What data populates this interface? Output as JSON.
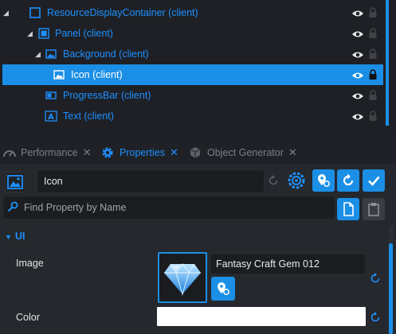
{
  "hierarchy": {
    "items": [
      {
        "label": "ResourceDisplayContainer (client)",
        "icon": "container-icon",
        "expanded": true,
        "depth": 0
      },
      {
        "label": "Panel (client)",
        "icon": "panel-icon",
        "expanded": true,
        "depth": 1
      },
      {
        "label": "Background (client)",
        "icon": "image-icon",
        "expanded": true,
        "depth": 2
      },
      {
        "label": "Icon (client)",
        "icon": "image-icon",
        "selected": true,
        "locked": true,
        "depth": 3
      },
      {
        "label": "ProgressBar (client)",
        "icon": "progressbar-icon",
        "depth": 2
      },
      {
        "label": "Text (client)",
        "icon": "text-icon",
        "depth": 2
      }
    ]
  },
  "tabs": [
    {
      "label": "Performance",
      "icon": "gauge-icon",
      "active": false
    },
    {
      "label": "Properties",
      "icon": "gear-icon",
      "active": true
    },
    {
      "label": "Object Generator",
      "icon": "cubes-icon",
      "active": false
    }
  ],
  "properties": {
    "object_name": "Icon",
    "search_placeholder": "Find Property by Name",
    "section_label": "UI",
    "image_label": "Image",
    "image_asset": "Fantasy Craft Gem 012",
    "color_label": "Color",
    "color_value": "#ffffff"
  },
  "colors": {
    "accent": "#1b8fe6",
    "link_text": "#1e90ff",
    "panel_bg": "#25282d",
    "hierarchy_bg": "#1e2025"
  }
}
